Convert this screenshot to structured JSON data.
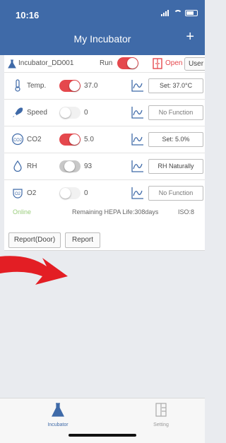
{
  "status_bar": {
    "time": "10:16"
  },
  "header": {
    "title": "My Incubator",
    "add_label": "+"
  },
  "incubator": {
    "name": "Incubator_DD001",
    "run_label": "Run",
    "run_on": true,
    "door_label": "Open",
    "user_button": "User"
  },
  "rows": [
    {
      "label": "Temp.",
      "value": "37.0",
      "toggle": "on",
      "button": "Set: 37.0°C",
      "icon": "thermometer-icon"
    },
    {
      "label": "Speed",
      "value": "0",
      "toggle": "off",
      "button": "No Function",
      "icon": "fan-icon"
    },
    {
      "label": "CO2",
      "value": "5.0",
      "toggle": "on",
      "button": "Set: 5.0%",
      "icon": "co2-icon"
    },
    {
      "label": "RH",
      "value": "93",
      "toggle": "grey",
      "button": "RH Naturally",
      "icon": "droplet-icon"
    },
    {
      "label": "O2",
      "value": "0",
      "toggle": "off",
      "button": "No Function",
      "icon": "o2-icon"
    }
  ],
  "status": {
    "online": "Online",
    "hepa": "Remaining HEPA Life:308days",
    "iso": "ISO:8"
  },
  "actions": {
    "report_door": "Report(Door)",
    "report": "Report"
  },
  "tabbar": {
    "incubator": "Incubator",
    "setting": "Setting"
  },
  "colors": {
    "header": "#3f6aa8",
    "toggle_on": "#e5484d",
    "arrow": "#e31e24",
    "online": "#9acd7c"
  }
}
